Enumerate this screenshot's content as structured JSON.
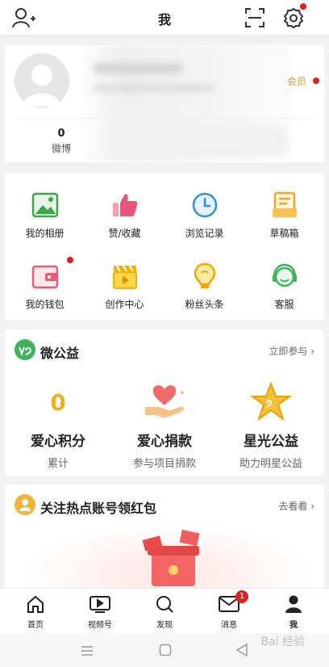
{
  "header": {
    "title": "我",
    "icons": [
      "add-friend-icon",
      "scan-icon",
      "settings-icon"
    ]
  },
  "profile": {
    "vip_label": "会员",
    "stats": [
      {
        "value": "0",
        "label": "微博"
      }
    ]
  },
  "grid": {
    "items": [
      {
        "label": "我的相册",
        "icon": "photo-album-icon"
      },
      {
        "label": "赞/收藏",
        "icon": "thumbs-up-icon"
      },
      {
        "label": "浏览记录",
        "icon": "history-clock-icon"
      },
      {
        "label": "草稿箱",
        "icon": "drafts-icon"
      },
      {
        "label": "我的钱包",
        "icon": "wallet-icon"
      },
      {
        "label": "创作中心",
        "icon": "creator-video-icon"
      },
      {
        "label": "粉丝头条",
        "icon": "fans-headline-icon"
      },
      {
        "label": "客服",
        "icon": "customer-service-icon"
      }
    ]
  },
  "charity": {
    "title": "微公益",
    "more": "立即参与",
    "columns": [
      {
        "visual": "0",
        "title": "爱心积分",
        "subtitle": "累计"
      },
      {
        "title": "爱心捐款",
        "subtitle": "参与项目捐款"
      },
      {
        "title": "星光公益",
        "subtitle": "助力明星公益"
      }
    ]
  },
  "hot": {
    "title": "关注热点账号领红包",
    "more": "去看看"
  },
  "tabbar": {
    "tabs": [
      {
        "label": "首页",
        "icon": "home-icon"
      },
      {
        "label": "视频号",
        "icon": "video-icon"
      },
      {
        "label": "发现",
        "icon": "discover-icon"
      },
      {
        "label": "消息",
        "icon": "message-icon",
        "badge": "1"
      },
      {
        "label": "我",
        "icon": "profile-icon"
      }
    ]
  },
  "watermark": "Bai 经验"
}
